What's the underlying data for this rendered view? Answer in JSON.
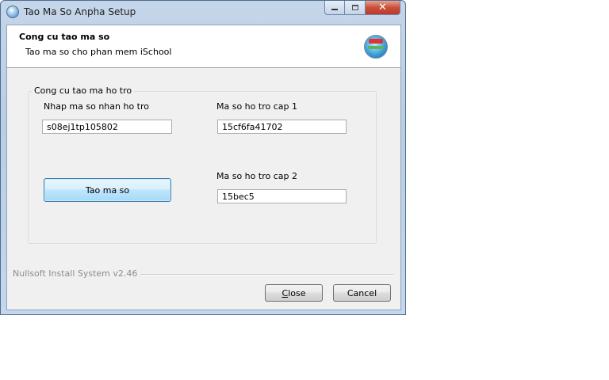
{
  "window": {
    "title": "Tao Ma So Anpha Setup",
    "controls": {
      "minimize": "▭",
      "maximize": "□",
      "close": "✕"
    }
  },
  "header": {
    "title": "Cong cu tao ma so",
    "subtitle": "Tao ma so cho phan mem iSchool"
  },
  "group": {
    "legend": "Cong cu tao ma ho tro",
    "support_code_label": "Nhap ma so nhan ho tro",
    "support_code_value": "s08ej1tp105802",
    "level1_label": "Ma so ho tro cap 1",
    "level1_value": "15cf6fa41702",
    "level2_label": "Ma so ho tro cap 2",
    "level2_value": "15bec5",
    "generate_button": "Tao ma so"
  },
  "footer": {
    "branding": "Nullsoft Install System v2.46",
    "close_button": "Close",
    "cancel_button": "Cancel"
  },
  "icons": {
    "app": "installer-icon",
    "header_logo": "setup-logo-icon"
  }
}
